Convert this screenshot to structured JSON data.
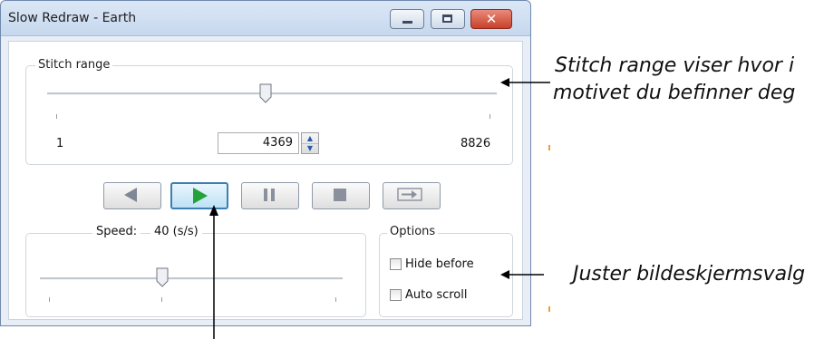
{
  "window": {
    "title": "Slow Redraw - Earth"
  },
  "stitch_range": {
    "legend": "Stitch range",
    "min_label": "1",
    "max_label": "8826",
    "current_value": "4369",
    "slider_fraction": 0.5
  },
  "playback": {
    "buttons": [
      "back-button",
      "play-button",
      "pause-button",
      "stop-button",
      "skip-forward-button"
    ],
    "active": "play-button"
  },
  "speed": {
    "label": "Speed:",
    "value": "40 (s/s)",
    "slider_fraction": 0.37
  },
  "options": {
    "legend": "Options",
    "hide_before": "Hide before",
    "auto_scroll": "Auto scroll"
  },
  "annotations": {
    "stitch_line1": "Stitch range viser hvor i",
    "stitch_line2": "motivet du befinner deg",
    "options_note": "Juster bildeskjermsvalg"
  },
  "colors": {
    "play_arrow": "#22a33a",
    "title_bar": "#c6d8ee",
    "close_button": "#c8402a"
  }
}
